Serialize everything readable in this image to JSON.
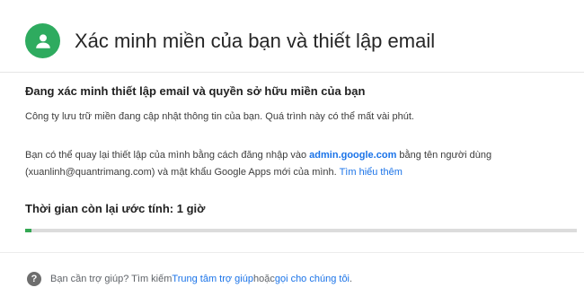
{
  "header": {
    "title": "Xác minh miền của bạn và thiết lập email",
    "avatar_icon": "person-icon",
    "avatar_color": "#2eab5f"
  },
  "main": {
    "section_title": "Đang xác minh thiết lập email và quyền sở hữu miền của bạn",
    "paragraph1": "Công ty lưu trữ miền đang cập nhật thông tin của bạn. Quá trình này có thể mất vài phút.",
    "paragraph2": {
      "text_before": "Bạn có thể quay lại thiết lập của mình bằng cách đăng nhập vào ",
      "admin_link": "admin.google.com",
      "text_middle": " bằng tên người dùng (xuanlinh@quantrimang.com) và mật khẩu Google Apps mới của mình. ",
      "learn_more_link": "Tìm hiểu thêm"
    },
    "time_label": "Thời gian còn lại ước tính: 1 giờ",
    "progress_percent": 1.2,
    "progress_color": "#34a853",
    "link_color": "#1a73e8"
  },
  "footer": {
    "help_icon": "help-circle-icon",
    "help_icon_glyph": "?",
    "text_before": "Bạn cần trợ giúp? Tìm kiếm ",
    "help_center_link": "Trung tâm trợ giúp",
    "text_middle": " hoặc ",
    "contact_link": "gọi cho chúng tôi",
    "text_after": "."
  }
}
